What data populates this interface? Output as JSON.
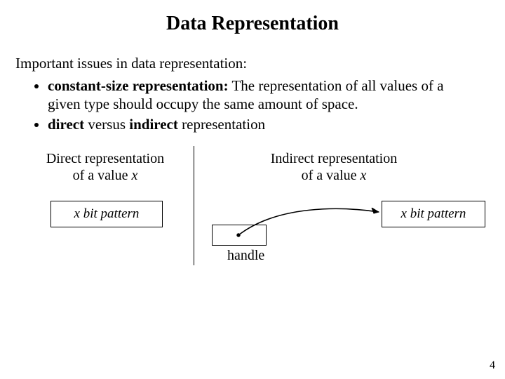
{
  "title": "Data Representation",
  "intro": "Important issues in data representation:",
  "bullets": {
    "b1_bold": "constant-size representation:",
    "b1_rest": " The representation of all values of a given type should occupy the same amount of space.",
    "b2_bold_a": "direct",
    "b2_plain_a": " versus ",
    "b2_bold_b": "indirect",
    "b2_plain_b": " representation"
  },
  "diagram": {
    "left_caption_line1": "Direct representation",
    "left_caption_line2_a": "of a value ",
    "left_caption_line2_x": "x",
    "right_caption_line1": "Indirect representation",
    "right_caption_line2_a": "of a value ",
    "right_caption_line2_x": "x",
    "box_left": "x bit pattern",
    "box_right": "x bit pattern",
    "handle_label": "handle"
  },
  "page_number": "4"
}
